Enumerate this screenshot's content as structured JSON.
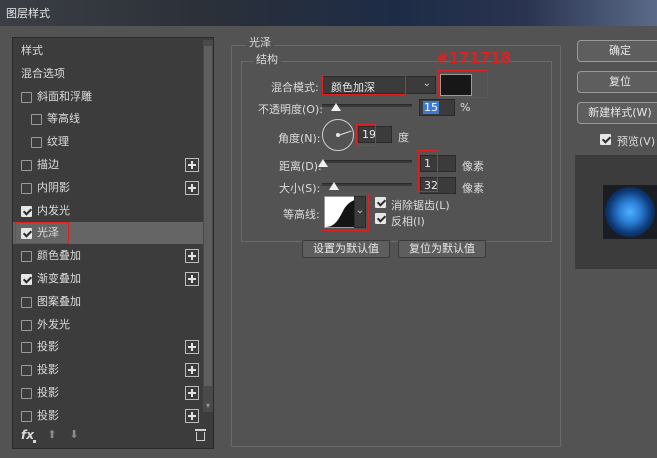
{
  "window": {
    "title": "图层样式"
  },
  "styles_list": {
    "items": [
      {
        "label": "样式",
        "checkbox": false,
        "checked": false,
        "plus": false,
        "indent": "none",
        "selected": false
      },
      {
        "label": "混合选项",
        "checkbox": false,
        "checked": false,
        "plus": false,
        "indent": "none",
        "selected": false
      },
      {
        "label": "斜面和浮雕",
        "checkbox": true,
        "checked": false,
        "plus": false,
        "indent": "normal",
        "selected": false
      },
      {
        "label": "等高线",
        "checkbox": true,
        "checked": false,
        "plus": false,
        "indent": "sub",
        "selected": false
      },
      {
        "label": "纹理",
        "checkbox": true,
        "checked": false,
        "plus": false,
        "indent": "sub",
        "selected": false
      },
      {
        "label": "描边",
        "checkbox": true,
        "checked": false,
        "plus": true,
        "indent": "normal",
        "selected": false
      },
      {
        "label": "内阴影",
        "checkbox": true,
        "checked": false,
        "plus": true,
        "indent": "normal",
        "selected": false
      },
      {
        "label": "内发光",
        "checkbox": true,
        "checked": true,
        "plus": false,
        "indent": "normal",
        "selected": false
      },
      {
        "label": "光泽",
        "checkbox": true,
        "checked": true,
        "plus": false,
        "indent": "normal",
        "selected": true
      },
      {
        "label": "颜色叠加",
        "checkbox": true,
        "checked": false,
        "plus": true,
        "indent": "normal",
        "selected": false
      },
      {
        "label": "渐变叠加",
        "checkbox": true,
        "checked": true,
        "plus": true,
        "indent": "normal",
        "selected": false
      },
      {
        "label": "图案叠加",
        "checkbox": true,
        "checked": false,
        "plus": false,
        "indent": "normal",
        "selected": false
      },
      {
        "label": "外发光",
        "checkbox": true,
        "checked": false,
        "plus": false,
        "indent": "normal",
        "selected": false
      },
      {
        "label": "投影",
        "checkbox": true,
        "checked": false,
        "plus": true,
        "indent": "normal",
        "selected": false
      },
      {
        "label": "投影",
        "checkbox": true,
        "checked": false,
        "plus": true,
        "indent": "normal",
        "selected": false
      },
      {
        "label": "投影",
        "checkbox": true,
        "checked": false,
        "plus": true,
        "indent": "normal",
        "selected": false
      },
      {
        "label": "投影",
        "checkbox": true,
        "checked": false,
        "plus": true,
        "indent": "normal",
        "selected": false
      }
    ],
    "footer": {
      "fx_label": "fx"
    }
  },
  "satin": {
    "section_title": "光泽",
    "structure_title": "结构",
    "blend_mode_label": "混合模式:",
    "blend_mode_value": "颜色加深",
    "color_hex": "#171718",
    "color_annotation": "#171718",
    "opacity_label": "不透明度(O):",
    "opacity_value": "15",
    "opacity_unit": "%",
    "opacity_fraction": 0.15,
    "angle_label": "角度(N):",
    "angle_value": "19",
    "angle_unit": "度",
    "distance_label": "距离(D):",
    "distance_value": "1",
    "distance_unit": "像素",
    "distance_fraction": 0.01,
    "size_label": "大小(S):",
    "size_value": "32",
    "size_unit": "像素",
    "size_fraction": 0.13,
    "contour_label": "等高线:",
    "antialias_label": "消除锯齿(L)",
    "antialias_checked": true,
    "invert_label": "反相(I)",
    "invert_checked": true,
    "set_default_label": "设置为默认值",
    "reset_default_label": "复位为默认值"
  },
  "actions": {
    "ok_label": "确定",
    "reset_label": "复位",
    "new_style_label": "新建样式(W)",
    "preview_label": "预览(V)",
    "preview_checked": true
  },
  "colors": {
    "annotation_red": "#e02020",
    "shadow_color": "#171718"
  }
}
